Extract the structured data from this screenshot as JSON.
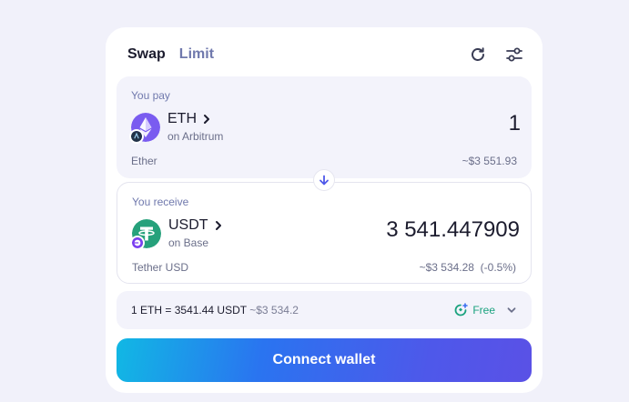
{
  "tabs": {
    "swap": "Swap",
    "limit": "Limit"
  },
  "icons": {
    "refresh": "refresh-icon",
    "settings": "sliders-icon",
    "flip": "arrow-down-icon",
    "fee": "gas-sparkle-icon",
    "expand": "chevron-down-icon"
  },
  "pay": {
    "label": "You pay",
    "symbol": "ETH",
    "network": "on Arbitrum",
    "amount": "1",
    "name": "Ether",
    "usd": "~$3 551.93"
  },
  "receive": {
    "label": "You receive",
    "symbol": "USDT",
    "network": "on Base",
    "amount": "3 541.447909",
    "name": "Tether USD",
    "usd": "~$3 534.28",
    "impact": "(-0.5%)"
  },
  "rate": {
    "from": "1 ETH",
    "equals": "=",
    "to": "3541.44 USDT",
    "usd": "~$3 534.2"
  },
  "fee_label": "Free",
  "connect_label": "Connect wallet",
  "colors": {
    "accent": "#4e58ea",
    "fee_green": "#1aa27e",
    "eth": "#7a5cf0",
    "usdt": "#26a17b"
  }
}
